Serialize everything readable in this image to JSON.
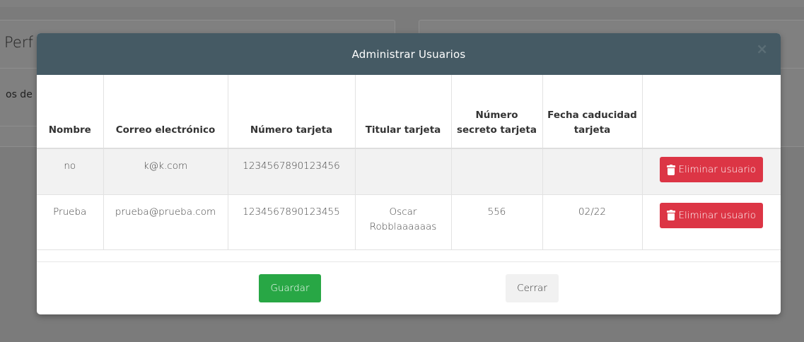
{
  "background": {
    "card_title_fragment": "Perf",
    "card_text_fragment": "os de"
  },
  "modal": {
    "title": "Administrar Usuarios",
    "close_label": "×",
    "columns": [
      "Nombre",
      "Correo electrónico",
      "Número tarjeta",
      "Titular tarjeta",
      "Número secreto tarjeta",
      "Fecha caducidad tarjeta",
      ""
    ],
    "rows": [
      {
        "nombre": "no",
        "correo": "k@k.com",
        "numero_tarjeta": "1234567890123456",
        "titular": "",
        "secreto": "",
        "caducidad": "",
        "action_label": "Eliminar usuario"
      },
      {
        "nombre": "Prueba",
        "correo": "prueba@prueba.com",
        "numero_tarjeta": "1234567890123455",
        "titular": "Oscar Robblaaaaaas",
        "secreto": "556",
        "caducidad": "02/22",
        "action_label": "Eliminar usuario"
      }
    ],
    "footer": {
      "save_label": "Guardar",
      "close_label": "Cerrar"
    }
  },
  "colors": {
    "header_bg": "#455a64",
    "danger": "#dc3545",
    "success": "#28a745",
    "backdrop": "#7b7b7b"
  },
  "icons": [
    "close-icon",
    "trash-icon"
  ]
}
